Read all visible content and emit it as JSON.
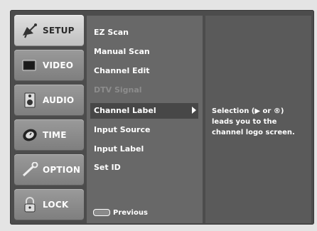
{
  "tabs": [
    {
      "label": "SETUP",
      "icon": "satellite-dish-icon",
      "active": true
    },
    {
      "label": "VIDEO",
      "icon": "tv-screen-icon",
      "active": false
    },
    {
      "label": "AUDIO",
      "icon": "speaker-icon",
      "active": false
    },
    {
      "label": "TIME",
      "icon": "clock-icon",
      "active": false
    },
    {
      "label": "OPTION",
      "icon": "wrench-icon",
      "active": false
    },
    {
      "label": "LOCK",
      "icon": "padlock-icon",
      "active": false
    }
  ],
  "menu": {
    "items": [
      {
        "label": "EZ Scan",
        "disabled": false
      },
      {
        "label": "Manual Scan",
        "disabled": false
      },
      {
        "label": "Channel Edit",
        "disabled": false
      },
      {
        "label": "DTV Signal",
        "disabled": true
      },
      {
        "label": "Channel Label",
        "disabled": false,
        "selected": true
      },
      {
        "label": "Input Source",
        "disabled": false
      },
      {
        "label": "Input Label",
        "disabled": false
      },
      {
        "label": "Set ID",
        "disabled": false
      }
    ],
    "footer_label": "Previous"
  },
  "info": {
    "text": "Selection (▶ or ®) leads you to the channel logo screen."
  },
  "colors": {
    "background": "#e4e4e4",
    "frame": "#4c4c4c",
    "tab": "#8c8c8c",
    "tab_active": "#d0d0d0",
    "menu": "#686868",
    "highlight": "#474747",
    "disabled_text": "#8c8c8c"
  }
}
